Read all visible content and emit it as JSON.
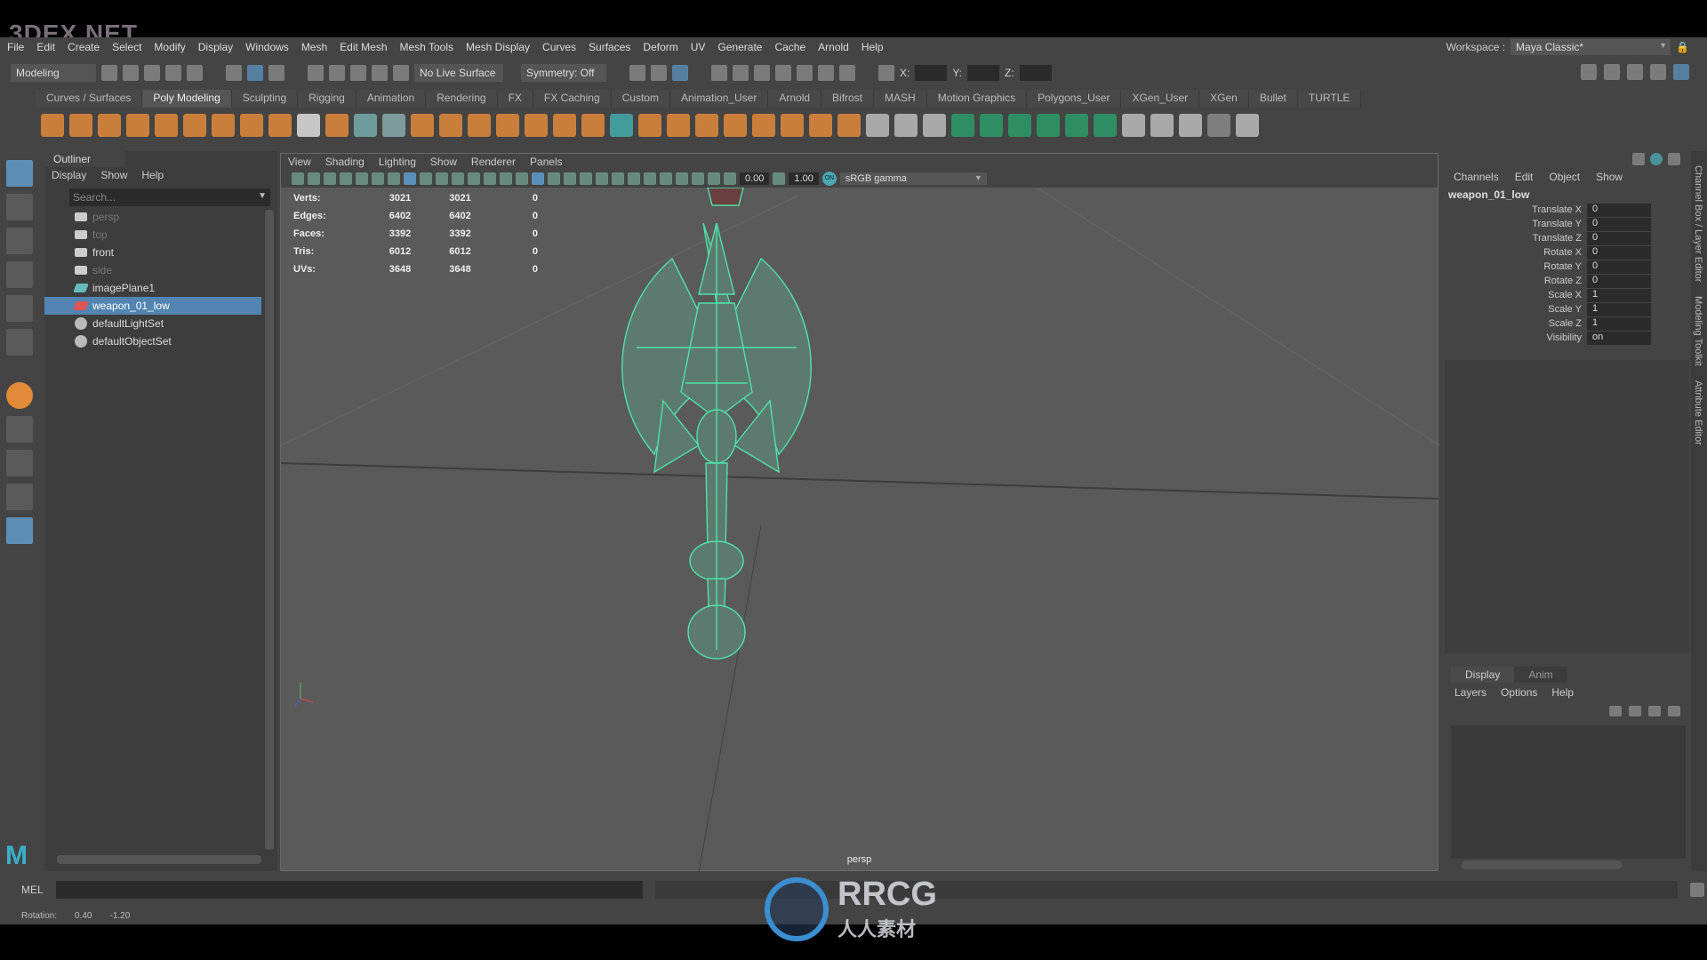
{
  "watermarks": {
    "top_left": "3DEX.NET",
    "bottom": "RRCG",
    "bottom_sub": "人人素材"
  },
  "menubar": [
    "File",
    "Edit",
    "Create",
    "Select",
    "Modify",
    "Display",
    "Windows",
    "Mesh",
    "Edit Mesh",
    "Mesh Tools",
    "Mesh Display",
    "Curves",
    "Surfaces",
    "Deform",
    "UV",
    "Generate",
    "Cache",
    "Arnold",
    "Help"
  ],
  "workspace": {
    "label": "Workspace :",
    "value": "Maya Classic*"
  },
  "toolbar": {
    "mode": "Modeling",
    "live_surface": "No Live Surface",
    "symmetry": "Symmetry: Off",
    "x_label": "X:",
    "y_label": "Y:",
    "z_label": "Z:"
  },
  "shelf_tabs": [
    "Curves / Surfaces",
    "Poly Modeling",
    "Sculpting",
    "Rigging",
    "Animation",
    "Rendering",
    "FX",
    "FX Caching",
    "Custom",
    "Animation_User",
    "Arnold",
    "Bifrost",
    "MASH",
    "Motion Graphics",
    "Polygons_User",
    "XGen_User",
    "XGen",
    "Bullet",
    "TURTLE"
  ],
  "shelf_active": "Poly Modeling",
  "accent": "#5285b1",
  "outliner": {
    "title": "Outliner",
    "menu": [
      "Display",
      "Show",
      "Help"
    ],
    "search_placeholder": "Search...",
    "items": [
      {
        "label": "persp",
        "icon": "camera-icon",
        "dim": true
      },
      {
        "label": "top",
        "icon": "camera-icon",
        "dim": true
      },
      {
        "label": "front",
        "icon": "camera-icon",
        "dim": false
      },
      {
        "label": "side",
        "icon": "camera-icon",
        "dim": true
      },
      {
        "label": "imagePlane1",
        "icon": "image-plane-icon",
        "dim": false
      },
      {
        "label": "weapon_01_low",
        "icon": "mesh-icon",
        "selected": true
      },
      {
        "label": "defaultLightSet",
        "icon": "set-icon"
      },
      {
        "label": "defaultObjectSet",
        "icon": "set-icon"
      }
    ]
  },
  "viewport": {
    "menu": [
      "View",
      "Shading",
      "Lighting",
      "Show",
      "Renderer",
      "Panels"
    ],
    "exposure": "0.00",
    "gamma": "1.00",
    "color_space": "sRGB gamma",
    "color_mgmt_toggle": "ON",
    "camera": "persp",
    "hud": [
      {
        "label": "Verts:",
        "a": "3021",
        "b": "3021",
        "c": "0"
      },
      {
        "label": "Edges:",
        "a": "6402",
        "b": "6402",
        "c": "0"
      },
      {
        "label": "Faces:",
        "a": "3392",
        "b": "3392",
        "c": "0"
      },
      {
        "label": "Tris:",
        "a": "6012",
        "b": "6012",
        "c": "0"
      },
      {
        "label": "UVs:",
        "a": "3648",
        "b": "3648",
        "c": "0"
      }
    ],
    "wire_color": "#4fe3a8"
  },
  "channel_box": {
    "menu": [
      "Channels",
      "Edit",
      "Object",
      "Show"
    ],
    "object": "weapon_01_low",
    "attrs": [
      {
        "n": "Translate X",
        "v": "0"
      },
      {
        "n": "Translate Y",
        "v": "0"
      },
      {
        "n": "Translate Z",
        "v": "0"
      },
      {
        "n": "Rotate X",
        "v": "0"
      },
      {
        "n": "Rotate Y",
        "v": "0"
      },
      {
        "n": "Rotate Z",
        "v": "0"
      },
      {
        "n": "Scale X",
        "v": "1"
      },
      {
        "n": "Scale Y",
        "v": "1"
      },
      {
        "n": "Scale Z",
        "v": "1"
      },
      {
        "n": "Visibility",
        "v": "on"
      }
    ]
  },
  "layer_editor": {
    "tabs": [
      "Display",
      "Anim"
    ],
    "menu": [
      "Layers",
      "Options",
      "Help"
    ]
  },
  "side_tabs": [
    "Channel Box / Layer Editor",
    "Modeling Toolkit",
    "Attribute Editor"
  ],
  "command_line": {
    "label": "MEL"
  },
  "help_line": {
    "label": "Rotation:",
    "v1": "0.40",
    "v2": "-1.20"
  }
}
